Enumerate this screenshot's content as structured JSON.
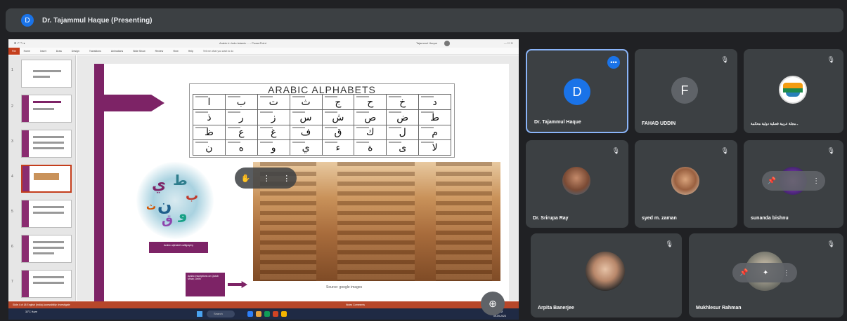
{
  "presenter_bar": {
    "avatar_letter": "D",
    "title": "Dr. Tajammul Haque (Presenting)"
  },
  "shared_screen": {
    "window_title": "Arabic in Indo-Islamic ... - PowerPoint",
    "user_name": "Tajammul Haque",
    "window_controls": "— ☐ ✕",
    "ribbon": {
      "file": "File",
      "tabs": [
        "Home",
        "Insert",
        "Draw",
        "Design",
        "Transitions",
        "Animations",
        "Slide Show",
        "Review",
        "View",
        "Help"
      ],
      "tell_me": "Tell me what you want to do"
    },
    "thumbnail_numbers": [
      "1",
      "2",
      "3",
      "4",
      "5",
      "6",
      "7"
    ],
    "slide": {
      "heading": "ARABIC ALPHABETS",
      "letters": [
        "ا",
        "ب",
        "ت",
        "ث",
        "ج",
        "ح",
        "خ",
        "د",
        "ذ",
        "ر",
        "ز",
        "س",
        "ش",
        "ص",
        "ض",
        "ط",
        "ظ",
        "ع",
        "غ",
        "ف",
        "ق",
        "ك",
        "ل",
        "م",
        "ن",
        "ه",
        "و",
        "ي",
        "ء",
        "ة",
        "ى",
        "لا"
      ],
      "cloud_letters": [
        "ي",
        "ط",
        "ب",
        "ن",
        "و",
        "ق",
        "ث"
      ],
      "cloud_caption": "Arabic alphabet calligraphy",
      "callout_text": "Arabic inscriptions on Qutub Minar, Delhi",
      "image_source": "Source: google images"
    },
    "overlay_controls": [
      "✋",
      "⋮",
      "⋮"
    ],
    "statusbar_left": "Slide 4 of 18   English (India)   Accessibility: Investigate",
    "statusbar_right": "Notes   Comments",
    "taskbar": {
      "weather": "32°C Haze",
      "search": "Search",
      "time": "1:56 PM",
      "date": "09-09-2023"
    },
    "zoom_icon": "⊕"
  },
  "participants": [
    {
      "name": "Dr. Tajammul Haque",
      "letter": "D",
      "color": "#1a73e8",
      "active": true,
      "more": "•••"
    },
    {
      "name": "FAHAD UDDIN",
      "letter": "F",
      "color": "#5f6368",
      "mic": "🎙"
    },
    {
      "name": "ـ مجلة عربية فصلية دولية محكمة",
      "mic": "🎙"
    },
    {
      "name": "Dr. Srirupa Ray",
      "mic": "🎙"
    },
    {
      "name": "syed m. zaman",
      "mic": "🎙"
    },
    {
      "name": "sunanda bishnu",
      "mic": "🎙",
      "pin": "📌",
      "more": "⋮"
    },
    {
      "name": "Arpita Banerjee",
      "mic": "🎙"
    },
    {
      "name": "Mukhlesur Rahman",
      "mic": "🎙",
      "pin": "📌",
      "effects": "✦",
      "more": "⋮"
    }
  ]
}
